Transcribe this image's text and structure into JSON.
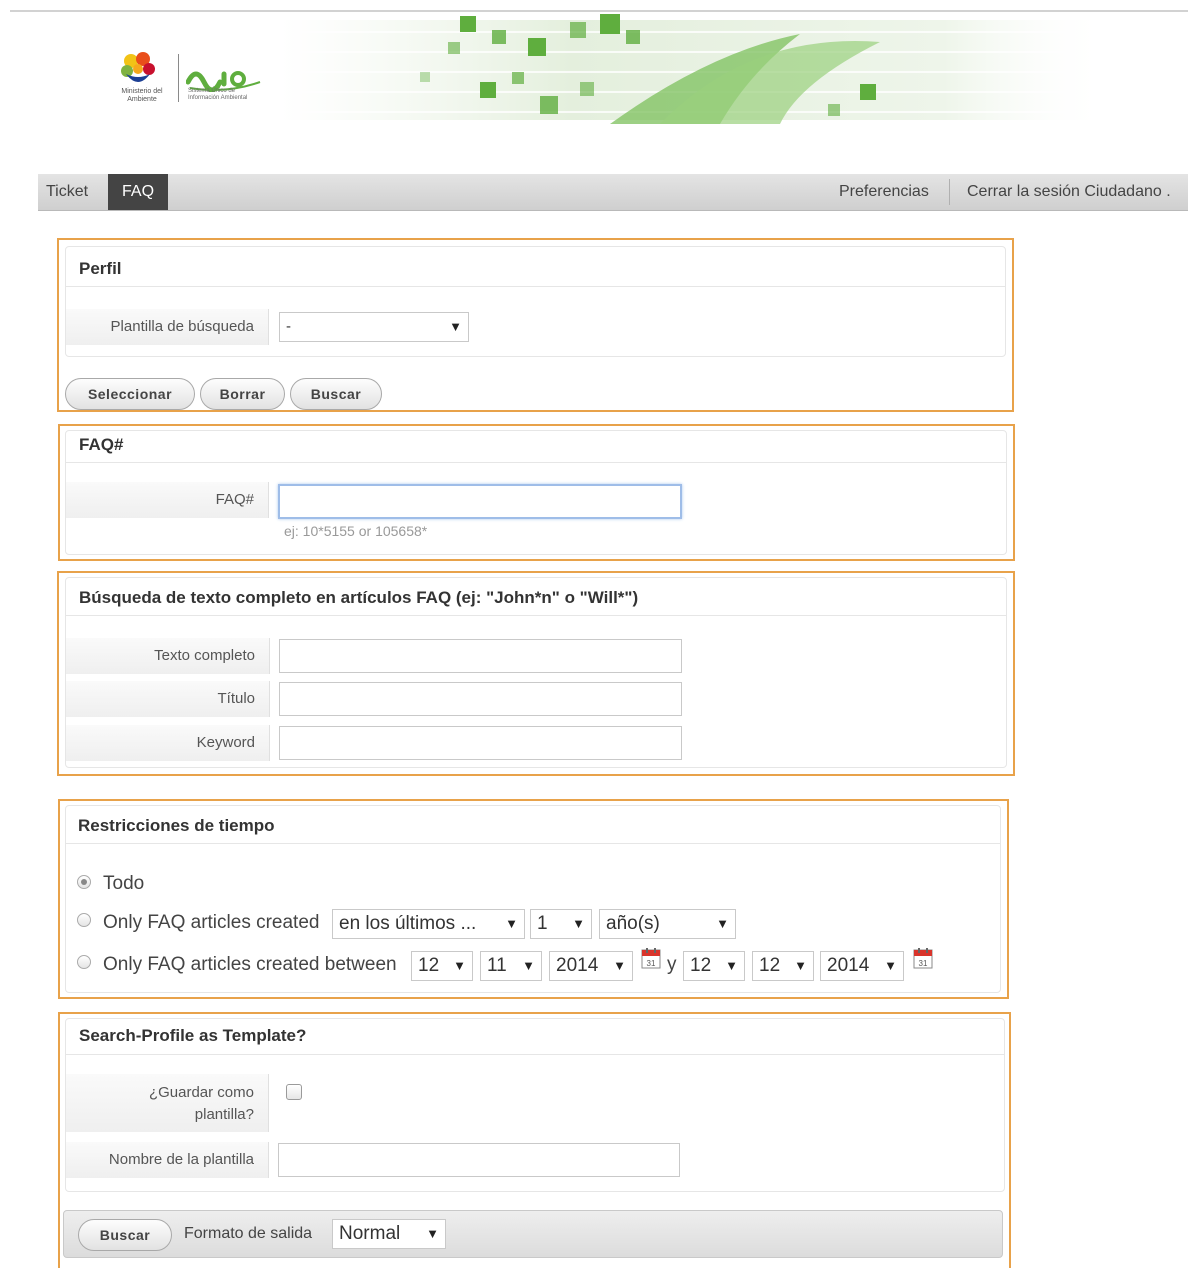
{
  "header": {
    "ministry_label": "Ministerio del Ambiente",
    "suia_label": "suia",
    "suia_sub": "Sistema Único de Información Ambiental"
  },
  "nav": {
    "items": [
      "Ticket",
      "FAQ"
    ],
    "preferences": "Preferencias",
    "logout": "Cerrar la sesión Ciudadano ."
  },
  "profile": {
    "title": "Perfil",
    "template_label": "Plantilla de búsqueda",
    "template_value": "-",
    "buttons": [
      "Seleccionar",
      "Borrar",
      "Buscar"
    ]
  },
  "faq_number": {
    "title": "FAQ#",
    "label": "FAQ#",
    "value": "",
    "hint": "ej: 10*5155 or 105658*"
  },
  "fulltext": {
    "title": "Búsqueda de texto completo en artículos FAQ (ej: \"John*n\" o \"Will*\")",
    "fields": [
      {
        "label": "Texto completo",
        "value": ""
      },
      {
        "label": "Título",
        "value": ""
      },
      {
        "label": "Keyword",
        "value": ""
      }
    ]
  },
  "time": {
    "title": "Restricciones de tiempo",
    "opt_all": "Todo",
    "opt_created": "Only FAQ articles created",
    "created_select1": "en los últimos ...",
    "created_select2": "1",
    "created_select3": "año(s)",
    "opt_between": "Only FAQ articles created between",
    "from_day": "12",
    "from_month": "11",
    "from_year": "2014",
    "and_label": "y",
    "to_day": "12",
    "to_month": "12",
    "to_year": "2014",
    "selected": "Todo"
  },
  "save_template": {
    "title": "Search-Profile as Template?",
    "save_label": "¿Guardar como plantilla?",
    "save_checked": false,
    "name_label": "Nombre de la plantilla",
    "name_value": ""
  },
  "footer": {
    "search_button": "Buscar",
    "format_label": "Formato de salida",
    "format_value": "Normal"
  },
  "colors": {
    "section_border": "#e8a24a",
    "nav_active_bg": "#444444",
    "banner_green": "#5fae3e"
  }
}
